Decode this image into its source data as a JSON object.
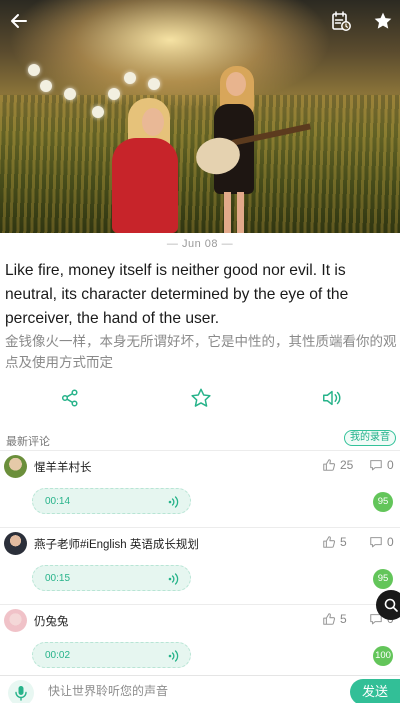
{
  "hero": {
    "alt": "Mother and daughter with guitar in a field"
  },
  "header": {
    "back_icon": "arrow-left-icon",
    "calendar_icon": "calendar-clock-icon",
    "favorite_icon": "star-icon"
  },
  "date": {
    "text": "Jun 08"
  },
  "quote": {
    "english": "Like fire, money itself is neither good nor evil. It is neutral, its character determined by the eye of the perceiver, the hand of the user.",
    "chinese": "金钱像火一样，本身无所谓好坏，它是中性的，其性质端看你的观点及使用方式而定"
  },
  "actions": {
    "share_icon": "share-icon",
    "star_icon": "star-outline-icon",
    "speaker_icon": "speaker-icon"
  },
  "comments_header": {
    "label": "最新评论",
    "my_recording": "我的录音"
  },
  "comments": [
    {
      "name": "惺羊羊村长",
      "likes": "25",
      "replies": "0",
      "duration": "00:14",
      "score": "95"
    },
    {
      "name": "燕子老师#iEnglish 英语成长规划",
      "likes": "5",
      "replies": "0",
      "duration": "00:15",
      "score": "95"
    },
    {
      "name": "仍兔兔",
      "likes": "5",
      "replies": "0",
      "duration": "00:02",
      "score": "100"
    }
  ],
  "bottom": {
    "placeholder": "快让世界聆听您的声音",
    "send": "发送"
  },
  "colors": {
    "accent": "#32bf97",
    "score": "#63c55a"
  }
}
